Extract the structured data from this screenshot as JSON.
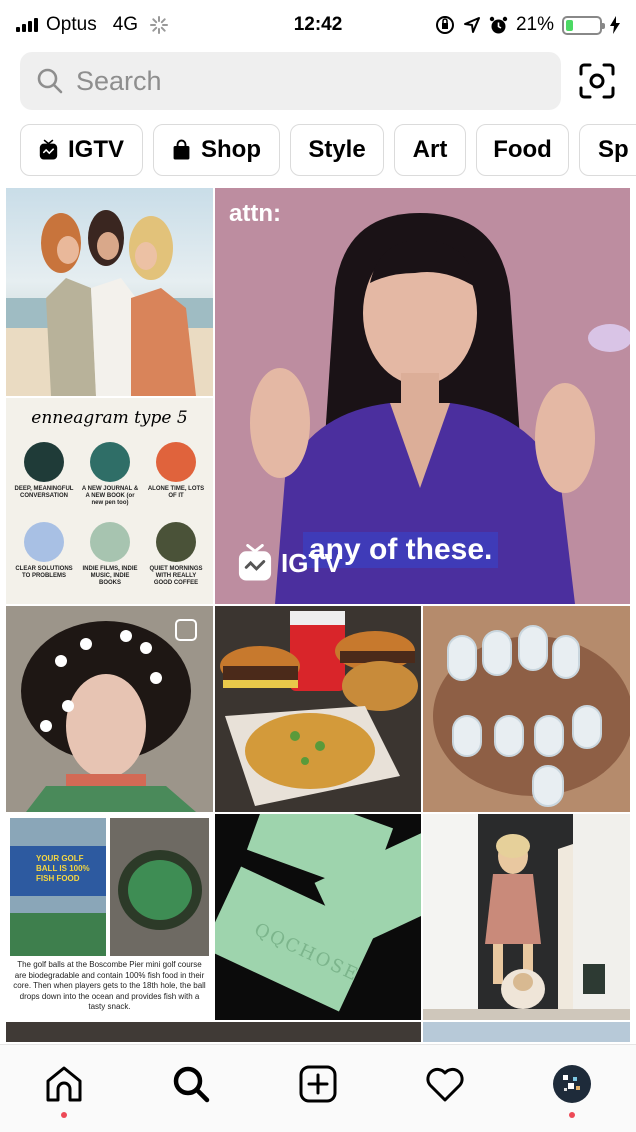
{
  "status_bar": {
    "carrier": "Optus",
    "network": "4G",
    "time": "12:42",
    "battery_percent": "21%",
    "battery_level": 0.21
  },
  "search": {
    "placeholder": "Search"
  },
  "chips": [
    {
      "label": "IGTV",
      "icon": "igtv-icon"
    },
    {
      "label": "Shop",
      "icon": "shopping-bag-icon"
    },
    {
      "label": "Style",
      "icon": ""
    },
    {
      "label": "Art",
      "icon": ""
    },
    {
      "label": "Food",
      "icon": ""
    },
    {
      "label": "Sp",
      "icon": ""
    }
  ],
  "grid": {
    "feature_tile": {
      "brand": "attn:",
      "caption": "any of these.",
      "badge": "IGTV"
    },
    "enneagram_tile": {
      "title": "enneagram type 5",
      "items": [
        {
          "label": "DEEP, MEANINGFUL CONVERSATION",
          "color": "#1f3b38"
        },
        {
          "label": "A NEW JOURNAL & A NEW BOOK (or new pen too)",
          "color": "#2f6e67"
        },
        {
          "label": "ALONE TIME, LOTS OF IT",
          "color": "#e0633c"
        },
        {
          "label": "CLEAR SOLUTIONS TO PROBLEMS",
          "color": "#a8c0e4"
        },
        {
          "label": "INDIE FILMS, INDIE MUSIC, INDIE BOOKS",
          "color": "#a7c4b0"
        },
        {
          "label": "QUIET MORNINGS WITH REALLY GOOD COFFEE",
          "color": "#4a5238"
        }
      ]
    },
    "golf_tile": {
      "sign": "YOUR GOLF BALL IS 100% FISH FOOD",
      "caption": "The golf balls at the Boscombe Pier mini golf course are biodegradable and contain 100% fish food in their core. Then when players gets to the 18th hole, the ball drops down into the ocean and provides fish with a tasty snack."
    },
    "card_tile": {
      "text": "QQCHOSE"
    }
  },
  "colors": {
    "accent_red": "#ed4956",
    "chip_border": "#dbdbdb",
    "search_bg": "#efefef",
    "igtv_caption_bg": "#3f3bb8"
  },
  "nav": [
    {
      "icon": "home-icon",
      "active_dot": true
    },
    {
      "icon": "search-icon",
      "active_dot": false
    },
    {
      "icon": "add-post-icon",
      "active_dot": false
    },
    {
      "icon": "heart-icon",
      "active_dot": false
    },
    {
      "icon": "profile-avatar",
      "active_dot": true
    }
  ]
}
